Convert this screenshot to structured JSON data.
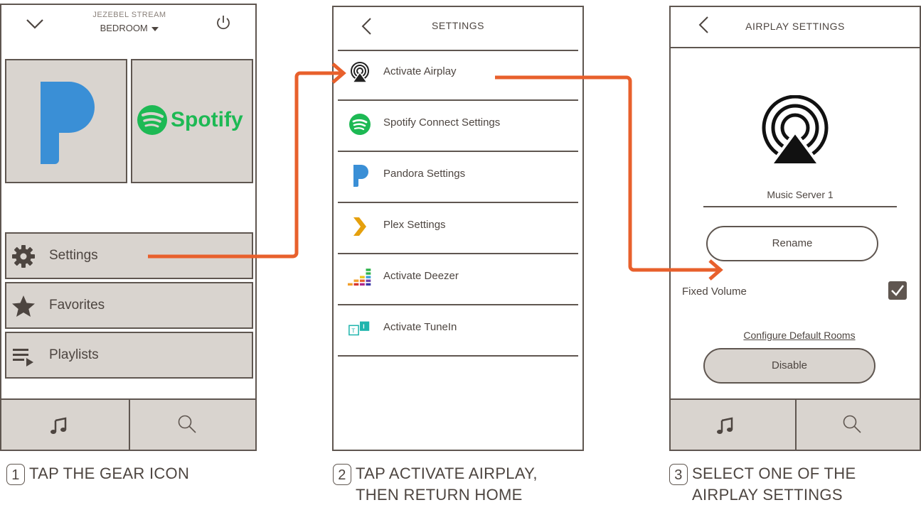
{
  "screen1": {
    "top_title": "JEZEBEL STREAM",
    "room": "BEDROOM",
    "icons": {
      "collapse": "chevron-down-icon",
      "power": "power-icon"
    },
    "tiles": [
      {
        "name": "pandora",
        "icon": "pandora-logo"
      },
      {
        "name": "spotify",
        "label": "Spotify",
        "icon": "spotify-logo"
      }
    ],
    "menu": [
      {
        "label": "Settings",
        "icon": "gear-icon"
      },
      {
        "label": "Favorites",
        "icon": "star-icon"
      },
      {
        "label": "Playlists",
        "icon": "playlist-icon"
      }
    ],
    "bottom": {
      "left_icon": "music-note-icon",
      "right_icon": "search-icon"
    }
  },
  "screen2": {
    "title": "SETTINGS",
    "items": [
      {
        "label": "Activate Airplay",
        "icon": "airplay-icon"
      },
      {
        "label": "Spotify Connect Settings",
        "icon": "spotify-icon"
      },
      {
        "label": "Pandora Settings",
        "icon": "pandora-icon"
      },
      {
        "label": "Plex Settings",
        "icon": "plex-icon"
      },
      {
        "label": "Activate Deezer",
        "icon": "deezer-icon"
      },
      {
        "label": "Activate TuneIn",
        "icon": "tunein-icon"
      }
    ]
  },
  "screen3": {
    "title": "AIRPLAY SETTINGS",
    "server_name": "Music Server 1",
    "rename_label": "Rename",
    "fixed_volume_label": "Fixed Volume",
    "fixed_volume_checked": true,
    "configure_label": "Configure Default Rooms",
    "disable_label": "Disable",
    "bottom": {
      "left_icon": "music-note-icon",
      "right_icon": "search-icon"
    }
  },
  "captions": [
    {
      "step": "1",
      "lines": [
        "TAP THE GEAR ICON"
      ]
    },
    {
      "step": "2",
      "lines": [
        "TAP ACTIVATE AIRPLAY,",
        "THEN RETURN HOME"
      ]
    },
    {
      "step": "3",
      "lines": [
        "SELECT ONE OF THE",
        "AIRPLAY SETTINGS"
      ]
    }
  ],
  "colors": {
    "arrow": "#e8602c",
    "tile_bg": "#d9d4cf",
    "frame": "#5f5650",
    "spotify": "#1db954",
    "pandora": "#3a8fd6",
    "plex": "#e5a00d"
  }
}
